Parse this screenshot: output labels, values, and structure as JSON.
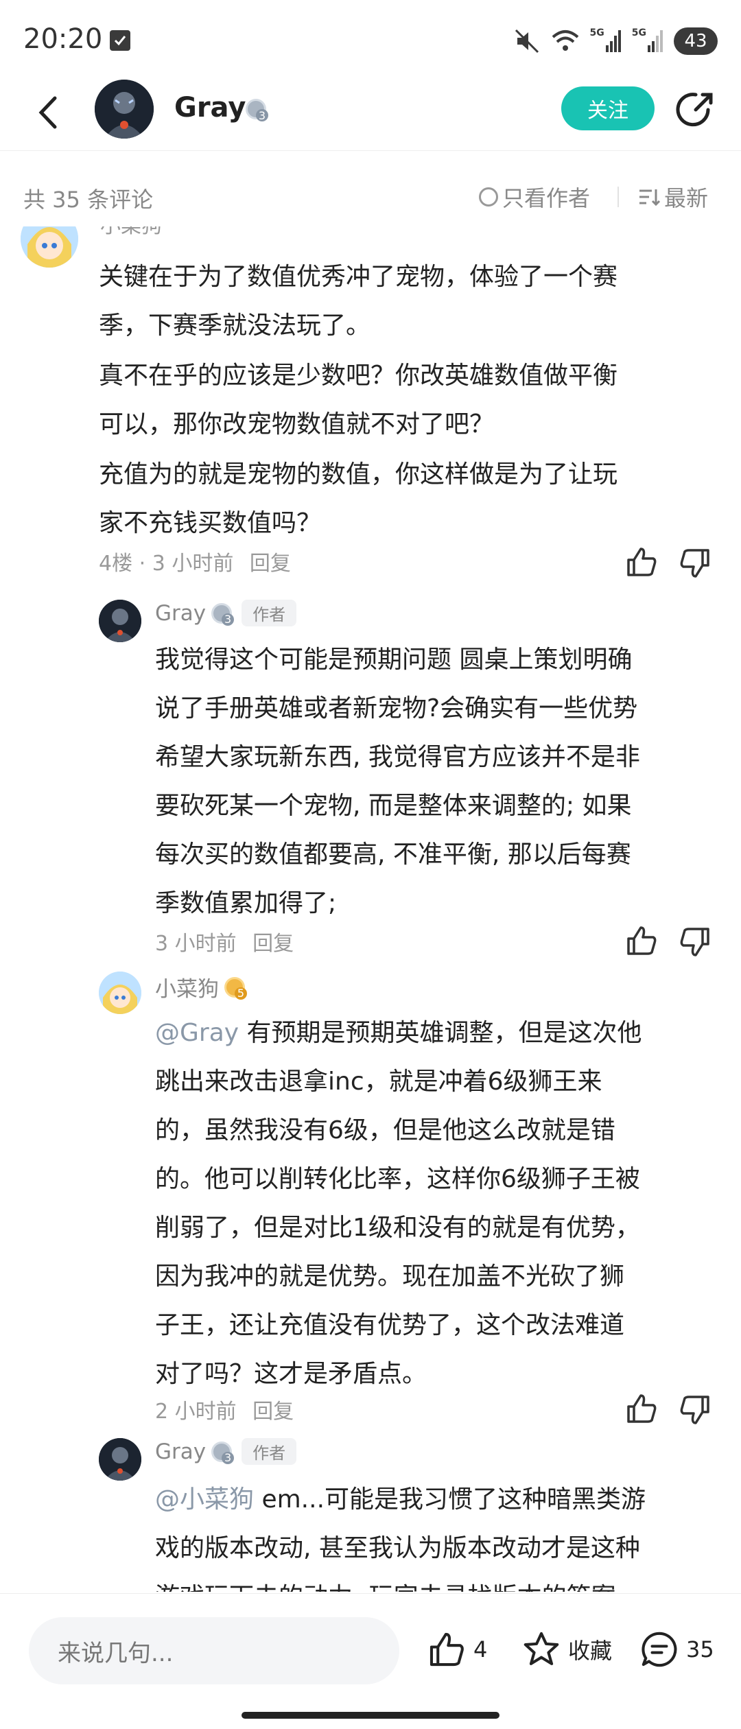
{
  "status_bar": {
    "time": "20:20",
    "network_1": "5G",
    "network_2": "5G",
    "battery": "43"
  },
  "header": {
    "author_name": "Gray",
    "author_level": "3",
    "follow_label": "关注"
  },
  "filter": {
    "comment_count": "共 35 条评论",
    "author_only": "只看作者",
    "sort_label": "最新"
  },
  "comments": {
    "main": {
      "partial_name": "小菜狗",
      "lines": [
        "关键在于为了数值优秀冲了宠物，体验了一个赛",
        "季，下赛季就没法玩了。",
        "真不在乎的应该是少数吧？你改英雄数值做平衡",
        "可以，那你改宠物数值就不对了吧？",
        "充值为的就是宠物的数值，你这样做是为了让玩",
        "家不充钱买数值吗？"
      ],
      "meta": "4楼 · 3 小时前",
      "reply_label": "回复"
    },
    "reply1": {
      "name": "Gray",
      "level": "3",
      "author_tag": "作者",
      "lines": [
        "我觉得这个可能是预期问题 圆桌上策划明确",
        "说了手册英雄或者新宠物?会确实有一些优势",
        "希望大家玩新东西, 我觉得官方应该并不是非",
        "要砍死某一个宠物, 而是整体来调整的; 如果",
        "每次买的数值都要高, 不准平衡, 那以后每赛",
        "季数值累加得了;"
      ],
      "meta": "3 小时前",
      "reply_label": "回复"
    },
    "reply2": {
      "name": "小菜狗",
      "level": "5",
      "mention": "@Gray",
      "first_line_rest": " 有预期是预期英雄调整，但是这次他",
      "lines": [
        "跳出来改击退拿inc，就是冲着6级狮王来",
        "的，虽然我没有6级，但是他这么改就是错",
        "的。他可以削转化比率，这样你6级狮子王被",
        "削弱了，但是对比1级和没有的就是有优势，",
        "因为我冲的就是优势。现在加盖不光砍了狮",
        "子王，还让充值没有优势了，这个改法难道",
        "对了吗？这才是矛盾点。"
      ],
      "meta": "2 小时前",
      "reply_label": "回复"
    },
    "reply3": {
      "name": "Gray",
      "level": "3",
      "author_tag": "作者",
      "mention": "@小菜狗",
      "first_line_rest": " em...可能是我习惯了这种暗黑类游",
      "lines": [
        "戏的版本改动, 甚至我认为版本改动才是这种",
        "游戏玩下去的动力; 玩家去寻找版本的答案;"
      ]
    }
  },
  "bottom_bar": {
    "input_placeholder": "来说几句...",
    "like_count": "4",
    "favorite_label": "收藏",
    "comment_count": "35"
  }
}
